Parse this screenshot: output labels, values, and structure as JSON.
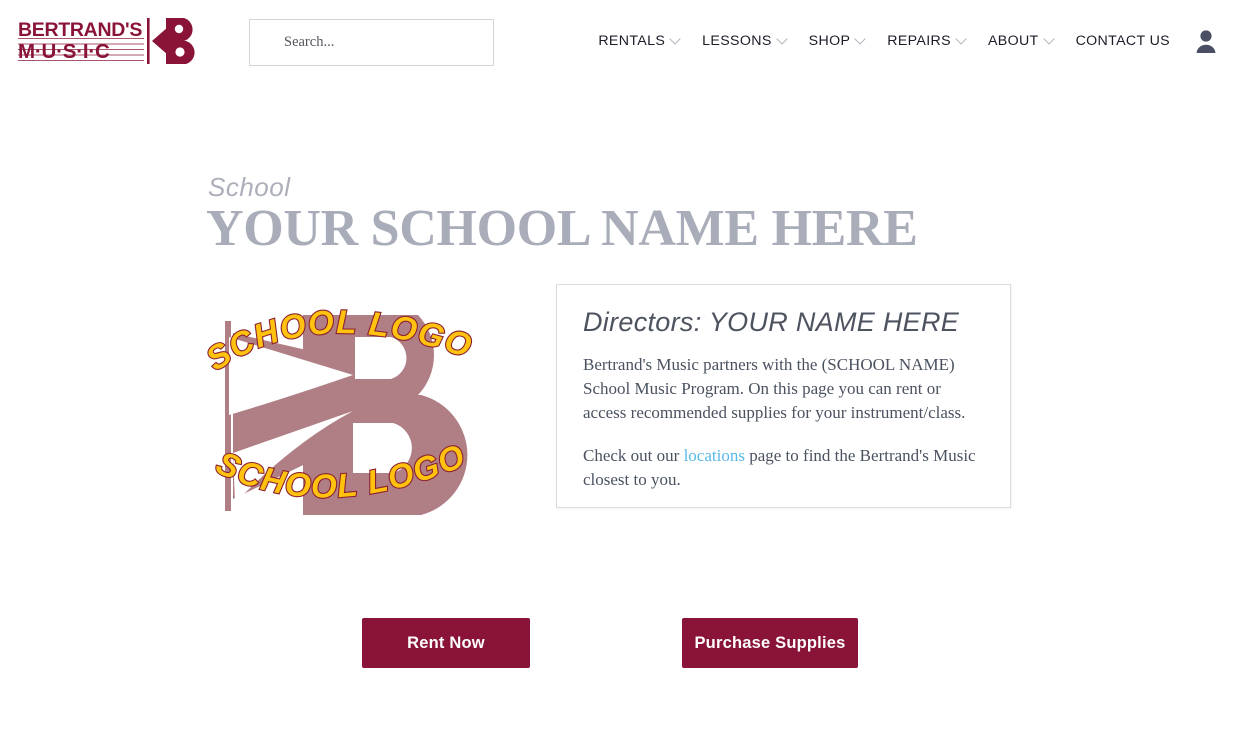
{
  "brand": {
    "name_line1": "BERTRAND'S",
    "name_line2": "M·U·S·I·C",
    "logo_icon": "bertrands-music-logo",
    "color": "#8a1438"
  },
  "search": {
    "placeholder": "Search...",
    "value": ""
  },
  "nav": {
    "items": [
      {
        "label": "RENTALS",
        "has_dropdown": true
      },
      {
        "label": "LESSONS",
        "has_dropdown": true
      },
      {
        "label": "SHOP",
        "has_dropdown": true
      },
      {
        "label": "REPAIRS",
        "has_dropdown": true
      },
      {
        "label": "ABOUT",
        "has_dropdown": true
      },
      {
        "label": "CONTACT US",
        "has_dropdown": false
      }
    ],
    "account_icon": "user-account-icon"
  },
  "hero": {
    "eyebrow": "School",
    "title": "YOUR SCHOOL NAME HERE",
    "title_color": "#a9adb9"
  },
  "school_logo": {
    "icon": "school-logo-placeholder",
    "arc_text_top": "SCHOOL LOGO",
    "arc_text_bottom": "SCHOOL LOGO",
    "text_fill": "#FFC20E",
    "text_outline": "#8B2131",
    "shape_color": "#b07f85"
  },
  "card": {
    "heading": "Directors: YOUR NAME HERE",
    "paragraph1": "Bertrand's Music partners with the (SCHOOL NAME) School Music Program.   On this page you can rent or access recommended supplies for your instrument/class.",
    "paragraph2_before": "Check out our ",
    "paragraph2_link": "locations",
    "paragraph2_after": " page to find the Bertrand's Music closest to you.",
    "link_color": "#59b8e8"
  },
  "cta": {
    "rent_label": "Rent Now",
    "supplies_label": "Purchase Supplies",
    "color": "#8a1438"
  }
}
